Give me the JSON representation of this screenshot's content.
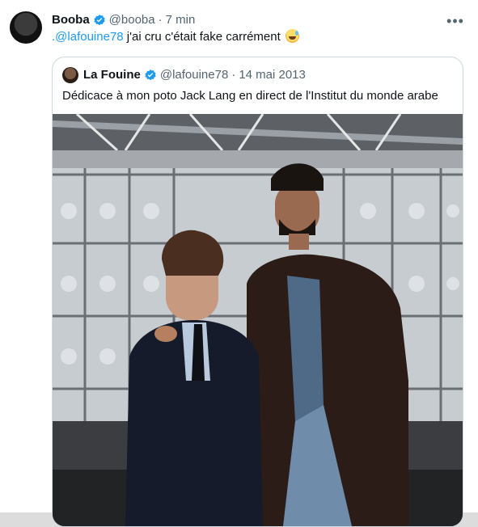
{
  "tweet": {
    "author_name": "Booba",
    "handle": "@booba",
    "separator": "·",
    "time": "7 min",
    "mention": ".@lafouine78",
    "text": " j'ai cru c'était fake carrément",
    "emoji": "grinning-sweat-face"
  },
  "quoted": {
    "author_name": "La Fouine",
    "handle": "@lafouine78",
    "separator": "·",
    "date": "14 mai 2013",
    "text": "Dédicace à mon poto Jack Lang en direct de l'Institut du monde arabe"
  },
  "colors": {
    "accent": "#1d9bf0",
    "text": "#0f1419",
    "muted": "#536471"
  }
}
